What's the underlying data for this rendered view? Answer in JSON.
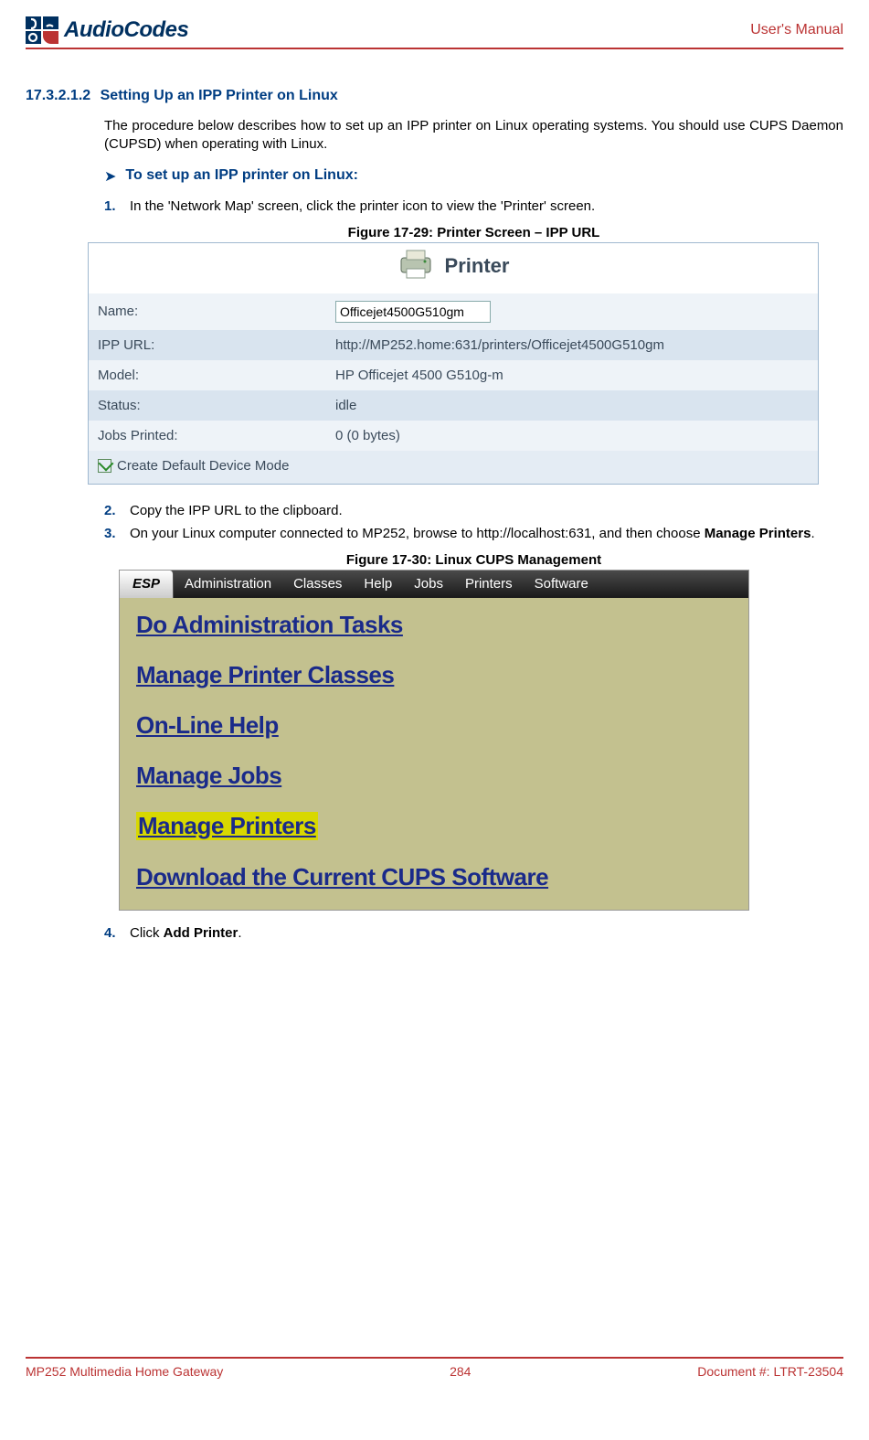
{
  "header": {
    "logo_text": "AudioCodes",
    "manual_label": "User's Manual"
  },
  "section": {
    "number": "17.3.2.1.2",
    "title": "Setting Up an IPP Printer on Linux"
  },
  "intro_para": "The procedure below describes how to set up an IPP printer on Linux operating systems. You should use CUPS Daemon (CUPSD) when operating with Linux.",
  "procedure_heading": "To set up an IPP printer on Linux:",
  "steps": {
    "s1": {
      "num": "1.",
      "text": "In the 'Network Map' screen, click the printer icon to view the 'Printer' screen."
    },
    "s2": {
      "num": "2.",
      "text": "Copy the IPP URL to the clipboard."
    },
    "s3": {
      "num": "3.",
      "text_a": "On your Linux computer connected to MP252, browse to http://localhost:631, and then choose ",
      "bold": "Manage Printers",
      "text_b": "."
    },
    "s4": {
      "num": "4.",
      "text_a": " Click ",
      "bold": "Add Printer",
      "text_b": "."
    }
  },
  "figures": {
    "f29": "Figure 17-29: Printer Screen – IPP URL",
    "f30": "Figure 17-30: Linux CUPS Management"
  },
  "printer_screen": {
    "title": "Printer",
    "rows": {
      "name_label": "Name:",
      "name_value": "Officejet4500G510gm",
      "ipp_label": "IPP URL:",
      "ipp_value": "http://MP252.home:631/printers/Officejet4500G510gm",
      "model_label": "Model:",
      "model_value": "HP Officejet 4500 G510g-m",
      "status_label": "Status:",
      "status_value": "idle",
      "jobs_label": "Jobs Printed:",
      "jobs_value": "0 (0 bytes)"
    },
    "checkbox_label": "Create Default Device Mode"
  },
  "cups": {
    "nav": {
      "esp": "ESP",
      "admin": "Administration",
      "classes": "Classes",
      "help": "Help",
      "jobs": "Jobs",
      "printers": "Printers",
      "software": "Software"
    },
    "links": {
      "do_admin": "Do Administration Tasks",
      "manage_classes": "Manage Printer Classes",
      "online_help": "On-Line Help",
      "manage_jobs": "Manage Jobs",
      "manage_printers": "Manage Printers",
      "download": "Download the Current CUPS Software"
    }
  },
  "footer": {
    "left": "MP252 Multimedia Home Gateway",
    "center": "284",
    "right": "Document #: LTRT-23504"
  }
}
